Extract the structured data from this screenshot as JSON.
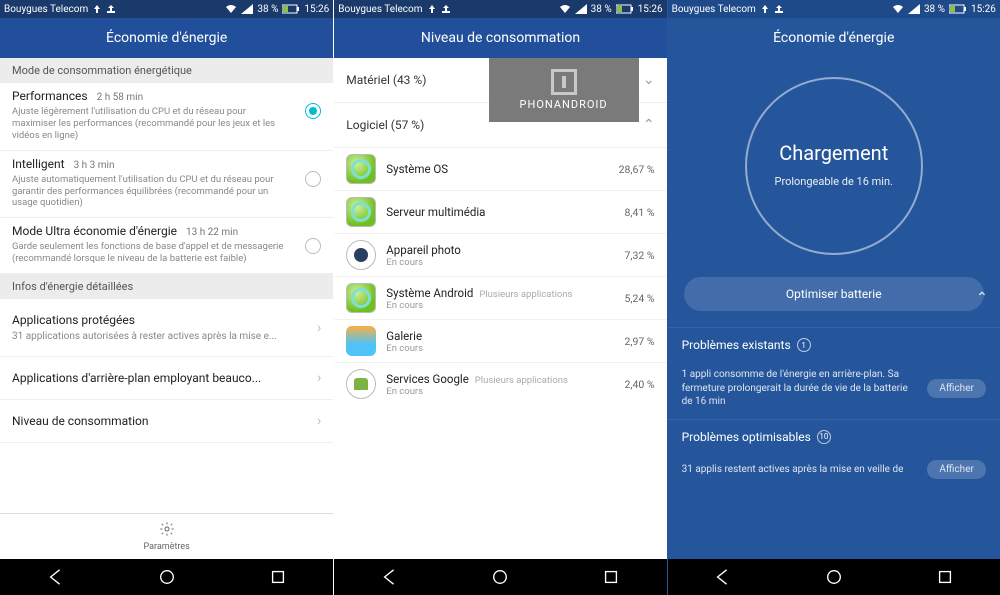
{
  "status": {
    "carrier": "Bouygues Telecom",
    "battery_pct": "38 %",
    "time": "15:26"
  },
  "screen1": {
    "title": "Économie d'énergie",
    "section_mode": "Mode de consommation énergétique",
    "modes": [
      {
        "title": "Performances",
        "time": "2 h 58 min",
        "desc": "Ajuste légèrement l'utilisation du CPU et du réseau pour maximiser les performances (recommandé pour les jeux et les vidéos en ligne)",
        "selected": true
      },
      {
        "title": "Intelligent",
        "time": "3 h 3 min",
        "desc": "Ajuste automatiquement l'utilisation du CPU et du réseau pour garantir des performances équilibrées (recommandé pour un usage quotidien)",
        "selected": false
      },
      {
        "title": "Mode Ultra économie d'énergie",
        "time": "13 h 22 min",
        "desc": "Garde seulement les fonctions de base d'appel et de messagerie (recommandé lorsque le niveau de la batterie est faible)",
        "selected": false
      }
    ],
    "section_info": "Infos d'énergie détaillées",
    "nav": [
      {
        "label": "Applications protégées",
        "sub": "31 applications autorisées à rester actives après la mise e..."
      },
      {
        "label": "Applications d'arrière-plan employant beauco...",
        "sub": ""
      },
      {
        "label": "Niveau de consommation",
        "sub": ""
      }
    ],
    "bottom": "Paramètres"
  },
  "screen2": {
    "title": "Niveau de consommation",
    "hardware": "Matériel (43 %)",
    "software": "Logiciel (57 %)",
    "watermark": "PHONANDROID",
    "apps": [
      {
        "name": "Système OS",
        "extra": "",
        "sub": "",
        "pct": "28,67 %",
        "ico": "green"
      },
      {
        "name": "Serveur multimédia",
        "extra": "",
        "sub": "",
        "pct": "8,41 %",
        "ico": "green"
      },
      {
        "name": "Appareil photo",
        "extra": "",
        "sub": "En cours",
        "pct": "7,32 %",
        "ico": "cam"
      },
      {
        "name": "Système Android",
        "extra": "Plusieurs applications",
        "sub": "En cours",
        "pct": "5,24 %",
        "ico": "green"
      },
      {
        "name": "Galerie",
        "extra": "",
        "sub": "En cours",
        "pct": "2,97 %",
        "ico": "gal"
      },
      {
        "name": "Services Google",
        "extra": "Plusieurs applications",
        "sub": "En cours",
        "pct": "2,40 %",
        "ico": "droid"
      }
    ]
  },
  "screen3": {
    "title": "Économie d'énergie",
    "circle_main": "Chargement",
    "circle_sub": "Prolongeable de 16 min.",
    "optimize": "Optimiser batterie",
    "sec_exist": "Problèmes existants",
    "sec_exist_count": "1",
    "sec_exist_note": "1 appli consomme de l'énergie en arrière-plan. Sa fermeture prolongerait la durée de vie de la batterie de 16 min",
    "sec_exist_btn": "Afficher",
    "sec_opt": "Problèmes optimisables",
    "sec_opt_count": "10",
    "sec_opt_note": "31 applis restent actives après la mise en veille de",
    "sec_opt_btn": "Afficher"
  }
}
